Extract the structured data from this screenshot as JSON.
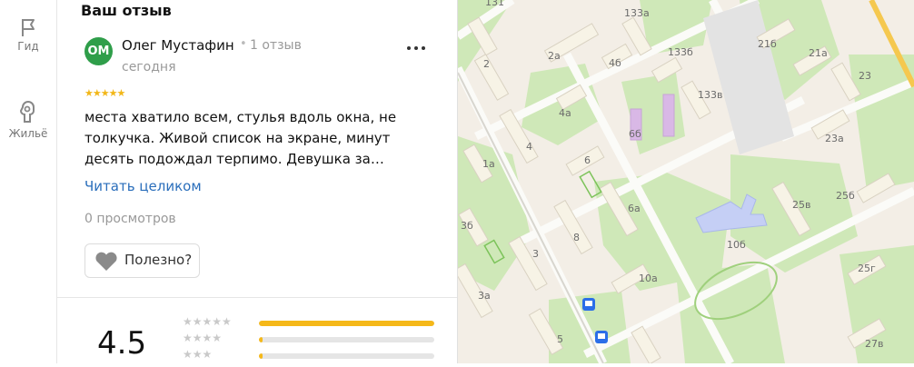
{
  "sidebar": {
    "items": [
      {
        "label": "Гид",
        "icon": "flag-icon"
      },
      {
        "label": "Жильё",
        "icon": "house-icon"
      }
    ]
  },
  "review": {
    "section_title": "Ваш отзыв",
    "avatar_initials": "ОМ",
    "author": "Олег Мустафин",
    "separator": "•",
    "reviews_count": "1 отзыв",
    "date": "сегодня",
    "rating_stars": "★★★★★",
    "text": "места хватило всем, стулья вдоль окна, не толкучка. Живой список на экране, минут десять подождал терпимо. Девушка за…",
    "read_more": "Читать целиком",
    "views": "0 просмотров",
    "helpful_label": "Полезно?"
  },
  "summary": {
    "rating": "4.5",
    "distribution": [
      {
        "stars": "★★★★★",
        "fraction": 1.0
      },
      {
        "stars": "★★★★",
        "fraction": 0.02
      },
      {
        "stars": "★★★",
        "fraction": 0.02
      }
    ]
  },
  "map": {
    "labels": [
      "131",
      "133а",
      "2",
      "2а",
      "4б",
      "133б",
      "21б",
      "21а",
      "23",
      "133в",
      "4а",
      "6б",
      "4",
      "23а",
      "1а",
      "6",
      "25в",
      "25б",
      "3б",
      "6а",
      "10б",
      "8",
      "3",
      "10а",
      "25г",
      "3а",
      "5",
      "27в"
    ],
    "colors": {
      "background": "#f3eee6",
      "green": "#cfe8b8",
      "road": "#fbfbf8",
      "building": "#f7f3e6",
      "school": "#c5cff5",
      "purple": "#d9b8e6",
      "bus": "#2b6ee8"
    }
  }
}
